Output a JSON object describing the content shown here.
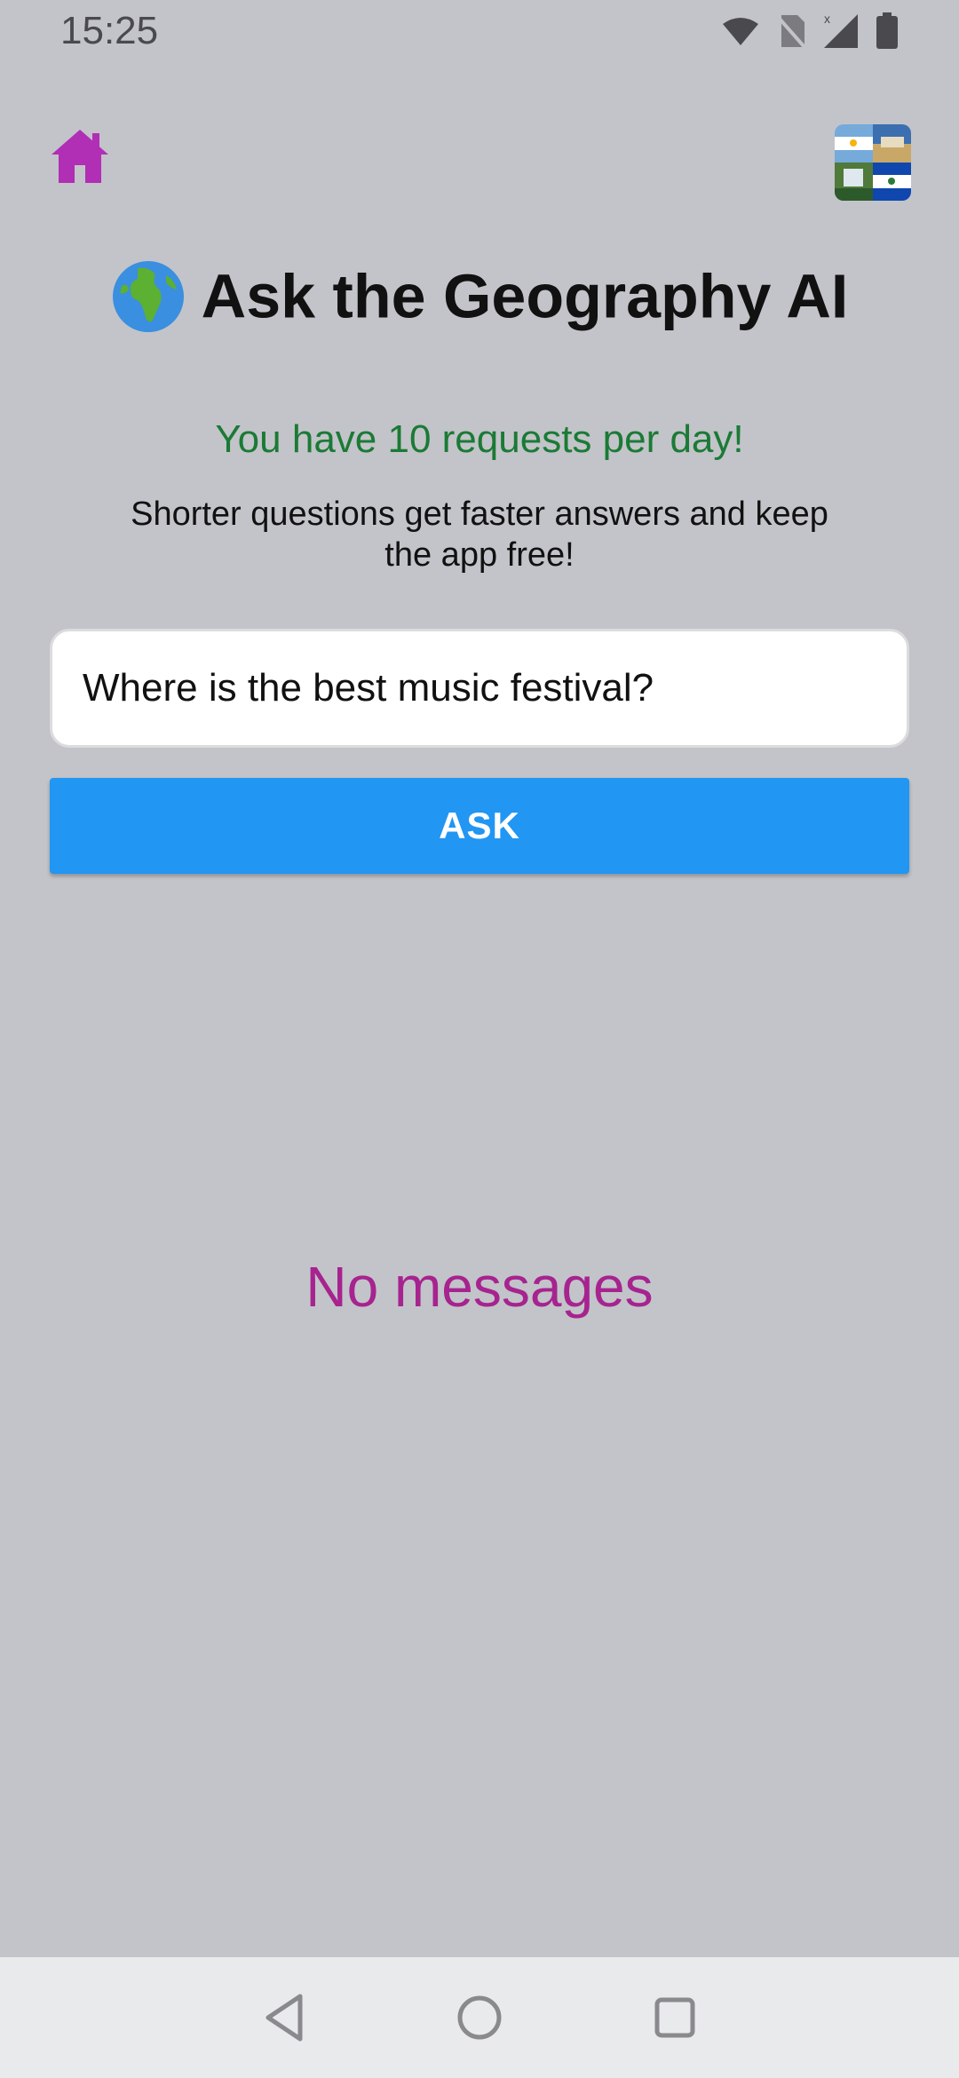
{
  "status_bar": {
    "time": "15:25",
    "icons": [
      "wifi-icon",
      "no-sim-icon",
      "signal-icon",
      "battery-icon"
    ]
  },
  "header": {
    "home_icon": "home-icon",
    "avatar_icon": "country-flags-collage"
  },
  "title": {
    "emoji": "🌍",
    "text": "Ask the Geography AI"
  },
  "info": {
    "requests_note": "You have 10 requests per day!",
    "tip": "Shorter questions get faster answers and keep the app free!"
  },
  "question": {
    "value": "Where is the best music festival?",
    "placeholder": ""
  },
  "ask_button": {
    "label": "ASK"
  },
  "messages": {
    "empty_text": "No messages"
  },
  "nav": {
    "icons": [
      "back-icon",
      "home-circle-icon",
      "recents-icon"
    ]
  },
  "colors": {
    "background": "#c2c4c9",
    "accent_magenta": "#b02fb4",
    "button_blue": "#2196f3",
    "note_green": "#1b7a35",
    "empty_text": "#a7238f"
  }
}
